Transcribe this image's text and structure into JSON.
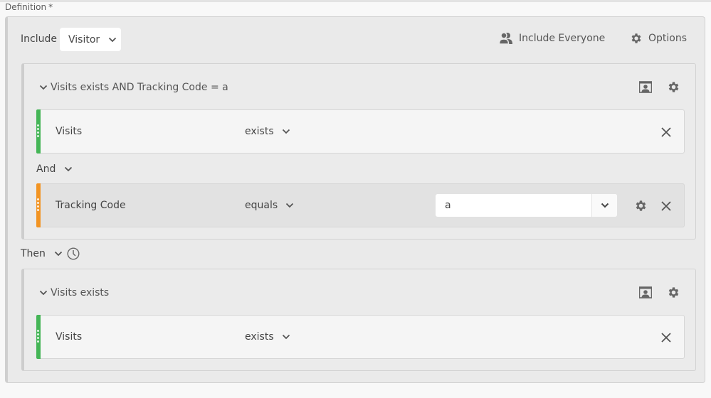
{
  "definition": {
    "label": "Definition",
    "required_mark": "*"
  },
  "header": {
    "include_label": "Include",
    "scope_dropdown": {
      "selected": "Visitor",
      "icon": "chevron-down-icon"
    },
    "include_everyone": {
      "label": "Include Everyone",
      "icon": "people-icon"
    },
    "options": {
      "label": "Options",
      "icon": "gear-icon"
    }
  },
  "containers": [
    {
      "title": "Visits exists AND Tracking Code = a",
      "header_icons": [
        "container-type-icon",
        "gear-icon"
      ],
      "rules": [
        {
          "name": "Visits",
          "operator": "exists",
          "bar_color": "#44b556"
        },
        {
          "name": "Tracking Code",
          "operator": "equals",
          "value": "a",
          "bar_color": "#f29423"
        }
      ],
      "logic_operator": "And"
    },
    {
      "title": "Visits exists",
      "header_icons": [
        "container-type-icon",
        "gear-icon"
      ],
      "rules": [
        {
          "name": "Visits",
          "operator": "exists",
          "bar_color": "#44b556"
        }
      ]
    }
  ],
  "sequence": {
    "label": "Then",
    "icon": "clock-icon"
  }
}
